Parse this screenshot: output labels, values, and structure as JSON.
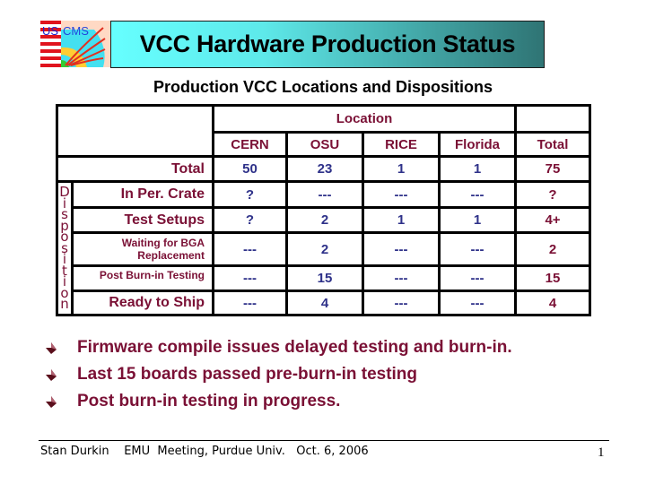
{
  "header": {
    "logo_text": "US CMS",
    "title": "VCC Hardware Production Status"
  },
  "subtitle": "Production VCC Locations and Dispositions",
  "table": {
    "group_header": "Location",
    "columns": [
      "CERN",
      "OSU",
      "RICE",
      "Florida",
      "Total"
    ],
    "total_row": {
      "label": "Total",
      "values": [
        "50",
        "23",
        "1",
        "1",
        "75"
      ]
    },
    "side_label": "Disposition",
    "side_letters": [
      "D",
      "i",
      "s",
      "p",
      "o",
      "s",
      "i",
      "t",
      "i",
      "o",
      "n"
    ],
    "rows": [
      {
        "label": "In Per. Crate",
        "values": [
          "?",
          "---",
          "---",
          "---",
          "?"
        ]
      },
      {
        "label": "Test Setups",
        "values": [
          "?",
          "2",
          "1",
          "1",
          "4+"
        ]
      },
      {
        "label_lines": [
          "Waiting for BGA",
          "Replacement"
        ],
        "values": [
          "---",
          "2",
          "---",
          "---",
          "2"
        ]
      },
      {
        "label": "Post Burn-in Testing",
        "values": [
          "---",
          "15",
          "---",
          "---",
          "15"
        ]
      },
      {
        "label": "Ready to Ship",
        "values": [
          "---",
          "4",
          "---",
          "---",
          "4"
        ]
      }
    ],
    "colors": {
      "header": "#7a1035",
      "value": "#2e3189"
    }
  },
  "bullets": [
    "Firmware compile issues delayed testing and burn-in.",
    "Last 15 boards passed pre-burn-in testing",
    "Post burn-in testing in progress."
  ],
  "footer": {
    "author": "Stan Durkin",
    "event": "EMU  Meeting, Purdue Univ.",
    "date": "Oct. 6, 2006",
    "page_number": "1"
  }
}
